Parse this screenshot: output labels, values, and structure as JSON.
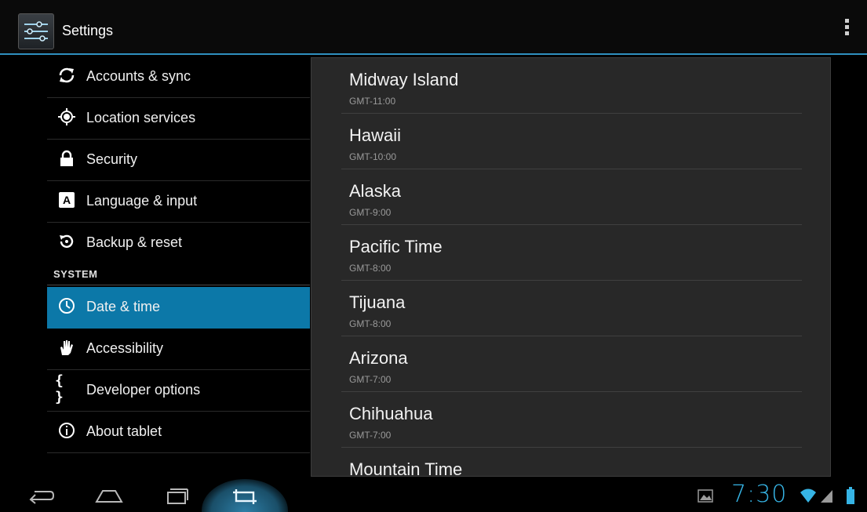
{
  "actionbar": {
    "title": "Settings",
    "app_icon": "settings-sliders-icon",
    "overflow_icon": "overflow-menu-icon"
  },
  "sidebar": {
    "items": [
      {
        "label": "Accounts & sync",
        "icon": "sync-icon"
      },
      {
        "label": "Location services",
        "icon": "location-icon"
      },
      {
        "label": "Security",
        "icon": "lock-icon"
      },
      {
        "label": "Language & input",
        "icon": "keyboard-letter-icon"
      },
      {
        "label": "Backup & reset",
        "icon": "restore-icon"
      }
    ],
    "section_header": "SYSTEM",
    "system_items": [
      {
        "label": "Date & time",
        "icon": "clock-icon",
        "selected": true
      },
      {
        "label": "Accessibility",
        "icon": "hand-icon"
      },
      {
        "label": "Developer options",
        "icon": "braces-icon",
        "glyph": "{ }"
      },
      {
        "label": "About tablet",
        "icon": "info-icon"
      }
    ]
  },
  "timezones": [
    {
      "name": "Midway Island",
      "offset": "GMT-11:00"
    },
    {
      "name": "Hawaii",
      "offset": "GMT-10:00"
    },
    {
      "name": "Alaska",
      "offset": "GMT-9:00"
    },
    {
      "name": "Pacific Time",
      "offset": "GMT-8:00"
    },
    {
      "name": "Tijuana",
      "offset": "GMT-8:00"
    },
    {
      "name": "Arizona",
      "offset": "GMT-7:00"
    },
    {
      "name": "Chihuahua",
      "offset": "GMT-7:00"
    },
    {
      "name": "Mountain Time",
      "offset": ""
    }
  ],
  "sysbar": {
    "clock": "7:30",
    "back_icon": "back-icon",
    "home_icon": "home-icon",
    "recents_icon": "recent-apps-icon",
    "screenshot_icon": "screenshot-icon",
    "gallery_icon": "image-notification-icon",
    "wifi_icon": "wifi-icon",
    "signal_icon": "signal-icon",
    "battery_icon": "battery-icon"
  },
  "colors": {
    "accent": "#0c78a8",
    "clock": "#36b4e5",
    "actionbar_rule": "#2f8fbf"
  }
}
